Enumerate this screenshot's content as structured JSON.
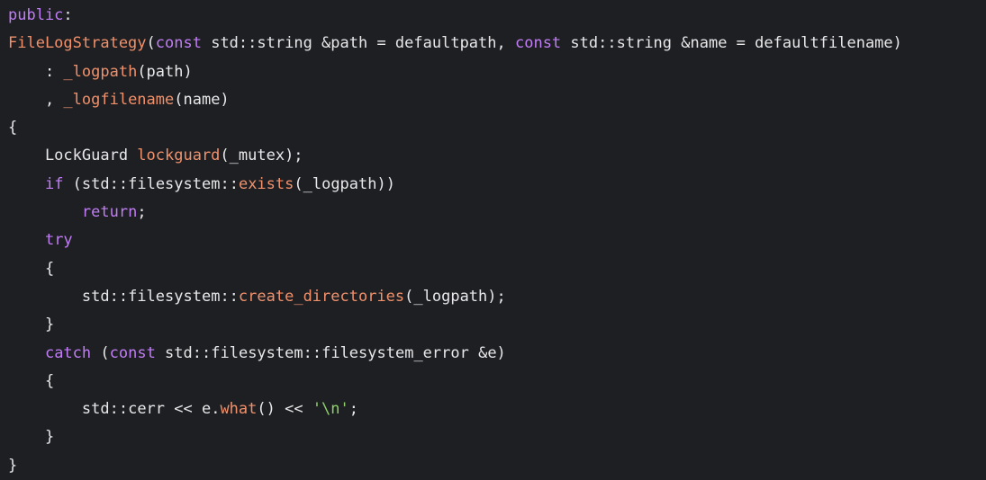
{
  "theme": {
    "background": "#1e1f22",
    "text": "#e8e8ea",
    "keyword": "#c17df6",
    "function": "#f0916c",
    "string": "#8fd06b"
  },
  "code_lines": [
    [
      {
        "text": "public",
        "type": "keyword"
      },
      {
        "text": ":",
        "type": "plain"
      }
    ],
    [
      {
        "text": "FileLogStrategy",
        "type": "function"
      },
      {
        "text": "(",
        "type": "plain"
      },
      {
        "text": "const",
        "type": "keyword"
      },
      {
        "text": " std",
        "type": "plain"
      },
      {
        "text": "::",
        "type": "plain"
      },
      {
        "text": "string &path = defaultpath, ",
        "type": "plain"
      },
      {
        "text": "const",
        "type": "keyword"
      },
      {
        "text": " std",
        "type": "plain"
      },
      {
        "text": "::",
        "type": "plain"
      },
      {
        "text": "string &name = defaultfilename)",
        "type": "plain"
      }
    ],
    [
      {
        "text": "    : ",
        "type": "plain"
      },
      {
        "text": "_logpath",
        "type": "function"
      },
      {
        "text": "(path)",
        "type": "plain"
      }
    ],
    [
      {
        "text": "    , ",
        "type": "plain"
      },
      {
        "text": "_logfilename",
        "type": "function"
      },
      {
        "text": "(name)",
        "type": "plain"
      }
    ],
    [
      {
        "text": "{",
        "type": "plain"
      }
    ],
    [
      {
        "text": "    LockGuard ",
        "type": "plain"
      },
      {
        "text": "lockguard",
        "type": "function"
      },
      {
        "text": "(_mutex);",
        "type": "plain"
      }
    ],
    [
      {
        "text": "    ",
        "type": "plain"
      },
      {
        "text": "if",
        "type": "keyword"
      },
      {
        "text": " (std",
        "type": "plain"
      },
      {
        "text": "::",
        "type": "plain"
      },
      {
        "text": "filesystem",
        "type": "plain"
      },
      {
        "text": "::",
        "type": "plain"
      },
      {
        "text": "exists",
        "type": "function"
      },
      {
        "text": "(_logpath))",
        "type": "plain"
      }
    ],
    [
      {
        "text": "        ",
        "type": "plain"
      },
      {
        "text": "return",
        "type": "keyword"
      },
      {
        "text": ";",
        "type": "plain"
      }
    ],
    [
      {
        "text": "    ",
        "type": "plain"
      },
      {
        "text": "try",
        "type": "keyword"
      }
    ],
    [
      {
        "text": "    {",
        "type": "plain"
      }
    ],
    [
      {
        "text": "        std",
        "type": "plain"
      },
      {
        "text": "::",
        "type": "plain"
      },
      {
        "text": "filesystem",
        "type": "plain"
      },
      {
        "text": "::",
        "type": "plain"
      },
      {
        "text": "create_directories",
        "type": "function"
      },
      {
        "text": "(_logpath);",
        "type": "plain"
      }
    ],
    [
      {
        "text": "    }",
        "type": "plain"
      }
    ],
    [
      {
        "text": "    ",
        "type": "plain"
      },
      {
        "text": "catch",
        "type": "keyword"
      },
      {
        "text": " (",
        "type": "plain"
      },
      {
        "text": "const",
        "type": "keyword"
      },
      {
        "text": " std",
        "type": "plain"
      },
      {
        "text": "::",
        "type": "plain"
      },
      {
        "text": "filesystem",
        "type": "plain"
      },
      {
        "text": "::",
        "type": "plain"
      },
      {
        "text": "filesystem_error &e)",
        "type": "plain"
      }
    ],
    [
      {
        "text": "    {",
        "type": "plain"
      }
    ],
    [
      {
        "text": "        std",
        "type": "plain"
      },
      {
        "text": "::",
        "type": "plain"
      },
      {
        "text": "cerr << e.",
        "type": "plain"
      },
      {
        "text": "what",
        "type": "function"
      },
      {
        "text": "() << ",
        "type": "plain"
      },
      {
        "text": "'\\n'",
        "type": "string"
      },
      {
        "text": ";",
        "type": "plain"
      }
    ],
    [
      {
        "text": "    }",
        "type": "plain"
      }
    ],
    [
      {
        "text": "}",
        "type": "plain"
      }
    ]
  ]
}
